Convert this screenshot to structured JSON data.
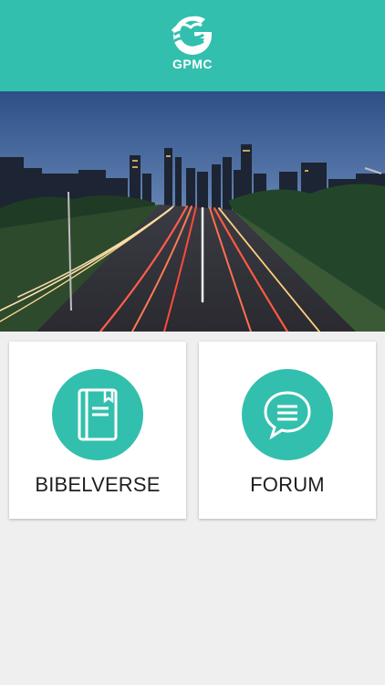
{
  "header": {
    "logo_text": "GPMC",
    "background_color": "#33bfad"
  },
  "hero": {
    "image": "city-highway-dusk"
  },
  "menu": {
    "items": [
      {
        "label": "BIBELVERSE",
        "icon": "book-icon"
      },
      {
        "label": "FORUM",
        "icon": "chat-bubble-icon"
      }
    ],
    "accent_color": "#33bfad"
  }
}
